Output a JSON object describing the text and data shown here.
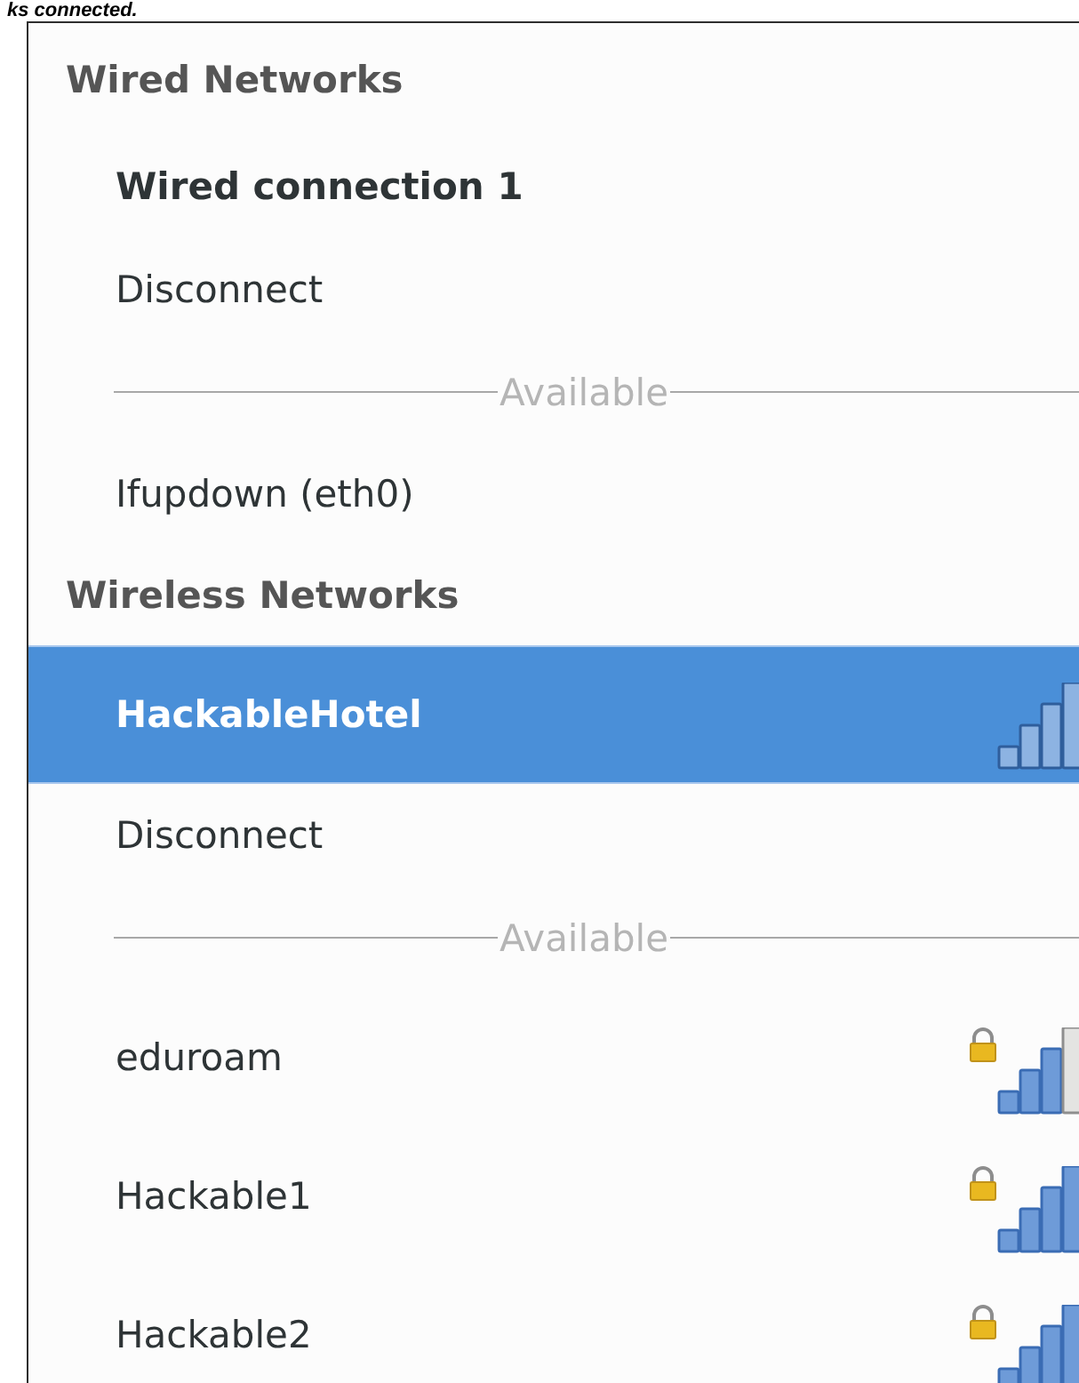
{
  "caption": "ks connected.",
  "sections": [
    {
      "title": "Wired Networks",
      "items": [
        {
          "kind": "network",
          "name": "Wired connection 1",
          "active": true,
          "selected": false
        },
        {
          "kind": "action",
          "label": "Disconnect"
        },
        {
          "kind": "separator",
          "label": "Available"
        },
        {
          "kind": "network",
          "name": "Ifupdown (eth0)",
          "active": false,
          "selected": false
        }
      ]
    },
    {
      "title": "Wireless Networks",
      "items": [
        {
          "kind": "network",
          "name": "HackableHotel",
          "active": true,
          "selected": true,
          "full_signal": true,
          "secured": false
        },
        {
          "kind": "action",
          "label": "Disconnect"
        },
        {
          "kind": "separator",
          "label": "Available"
        },
        {
          "kind": "network",
          "name": "eduroam",
          "active": false,
          "selected": false,
          "full_signal": false,
          "secured": true
        },
        {
          "kind": "network",
          "name": "Hackable1",
          "active": false,
          "selected": false,
          "full_signal": true,
          "secured": true
        },
        {
          "kind": "network",
          "name": "Hackable2",
          "active": false,
          "selected": false,
          "full_signal": true,
          "secured": true
        }
      ]
    }
  ]
}
